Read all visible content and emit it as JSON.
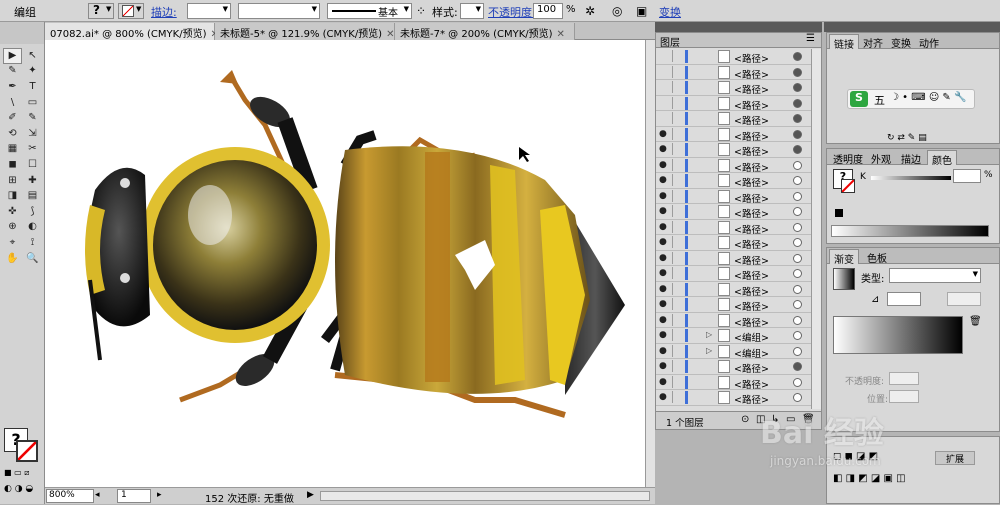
{
  "control_bar": {
    "group_label": "编组",
    "stroke_link": "描边:",
    "stroke_style": "基本",
    "style_label": "样式:",
    "opacity_link": "不透明度:",
    "opacity_value": "100",
    "opacity_unit": "%",
    "transform_link": "变换"
  },
  "tabs": [
    {
      "label": "07082.ai* @ 800% (CMYK/预览)"
    },
    {
      "label": "未标题-5* @ 121.9% (CMYK/预览)"
    },
    {
      "label": "未标题-7* @ 200% (CMYK/预览)"
    }
  ],
  "status": {
    "zoom": "800%",
    "artboard": "1",
    "undo_text": "152 次还原: 无重做"
  },
  "layers_panel": {
    "title": "图层",
    "rows": [
      {
        "name": "<路径>",
        "target_filled": true,
        "eye": false,
        "expand": false
      },
      {
        "name": "<路径>",
        "target_filled": true,
        "eye": false,
        "expand": false
      },
      {
        "name": "<路径>",
        "target_filled": true,
        "eye": false,
        "expand": false
      },
      {
        "name": "<路径>",
        "target_filled": true,
        "eye": false,
        "expand": false
      },
      {
        "name": "<路径>",
        "target_filled": true,
        "eye": false,
        "expand": false
      },
      {
        "name": "<路径>",
        "target_filled": true,
        "eye": true,
        "expand": false
      },
      {
        "name": "<路径>",
        "target_filled": true,
        "eye": true,
        "expand": false
      },
      {
        "name": "<路径>",
        "target_filled": false,
        "eye": true,
        "expand": false
      },
      {
        "name": "<路径>",
        "target_filled": false,
        "eye": true,
        "expand": false
      },
      {
        "name": "<路径>",
        "target_filled": false,
        "eye": true,
        "expand": false
      },
      {
        "name": "<路径>",
        "target_filled": false,
        "eye": true,
        "expand": false
      },
      {
        "name": "<路径>",
        "target_filled": false,
        "eye": true,
        "expand": false
      },
      {
        "name": "<路径>",
        "target_filled": false,
        "eye": true,
        "expand": false
      },
      {
        "name": "<路径>",
        "target_filled": false,
        "eye": true,
        "expand": false
      },
      {
        "name": "<路径>",
        "target_filled": false,
        "eye": true,
        "expand": false
      },
      {
        "name": "<路径>",
        "target_filled": false,
        "eye": true,
        "expand": false
      },
      {
        "name": "<路径>",
        "target_filled": false,
        "eye": true,
        "expand": false
      },
      {
        "name": "<路径>",
        "target_filled": false,
        "eye": true,
        "expand": false
      },
      {
        "name": "<编组>",
        "target_filled": false,
        "eye": true,
        "expand": true
      },
      {
        "name": "<编组>",
        "target_filled": false,
        "eye": true,
        "expand": true
      },
      {
        "name": "<路径>",
        "target_filled": true,
        "eye": true,
        "expand": false
      },
      {
        "name": "<路径>",
        "target_filled": false,
        "eye": true,
        "expand": false
      },
      {
        "name": "<路径>",
        "target_filled": false,
        "eye": true,
        "expand": false
      }
    ],
    "footer": "1 个图层"
  },
  "right_panels": {
    "top_tabs": [
      "链接",
      "对齐",
      "变换",
      "动作"
    ],
    "ime_label": "五",
    "color_tabs": [
      "透明度",
      "外观",
      "描边",
      "颜色"
    ],
    "k_label": "K",
    "k_unit": "%",
    "gradient_tabs": [
      "渐变",
      "色板"
    ],
    "type_label": "类型:",
    "opacity_label": "不透明度:",
    "position_label": "位置:",
    "bottom_label": "扩展"
  },
  "tools": [
    "▶",
    "↖",
    "✎",
    "✦",
    "✒",
    "T",
    "\\",
    "▭",
    "✐",
    "✎",
    "⟲",
    "⇲",
    "▦",
    "✂",
    "◼",
    "☐",
    "⊞",
    "✚",
    "◨",
    "▤",
    "✜",
    "⟆",
    "⊕",
    "◐",
    "⌖",
    "⟟",
    "✋",
    "🔍"
  ],
  "watermark": {
    "text": "Bai 经验",
    "sub": "jingyan.baidu.com"
  }
}
